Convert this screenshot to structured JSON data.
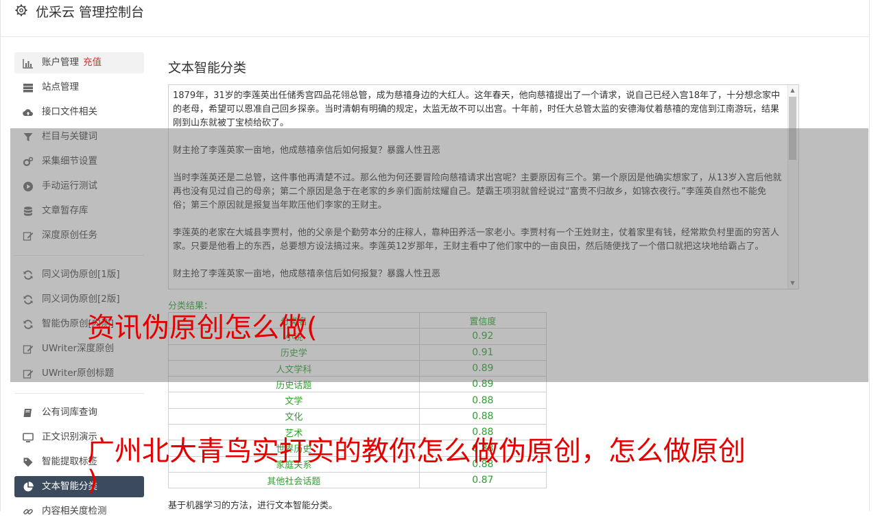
{
  "header": {
    "title": "优采云 管理控制台",
    "icon": "gear-icon"
  },
  "sidebar": {
    "groups": [
      [
        {
          "label": "账户管理",
          "badge": "充值",
          "icon": "bar-chart-icon"
        },
        {
          "label": "站点管理",
          "icon": "server-icon"
        },
        {
          "label": "接口文件相关",
          "icon": "cloud-upload-icon"
        },
        {
          "label": "栏目与关键词",
          "icon": "filter-icon"
        },
        {
          "label": "采集细节设置",
          "icon": "cogs-icon"
        },
        {
          "label": "手动运行测试",
          "icon": "play-circle-icon"
        },
        {
          "label": "文章暂存库",
          "icon": "database-icon"
        },
        {
          "label": "深度原创任务",
          "icon": "edit-icon"
        }
      ],
      [
        {
          "label": "同义词伪原创[1版]",
          "icon": "refresh-icon"
        },
        {
          "label": "同义词伪原创[2版]",
          "icon": "refresh-icon"
        },
        {
          "label": "智能伪原创[内测]",
          "icon": "refresh-icon"
        },
        {
          "label": "UWriter深度原创",
          "icon": "edit-icon"
        },
        {
          "label": "UWriter原创标题",
          "icon": "edit-icon"
        }
      ],
      [
        {
          "label": "公有词库查询",
          "icon": "book-icon"
        },
        {
          "label": "正文识别演示",
          "icon": "monitor-icon"
        },
        {
          "label": "智能提取标签",
          "icon": "tag-icon"
        },
        {
          "label": "文本智能分类",
          "icon": "pie-chart-icon"
        },
        {
          "label": "内容相关度检测",
          "icon": "link-icon"
        }
      ]
    ]
  },
  "main": {
    "title": "文本智能分类",
    "text_paragraphs": [
      "1879年，31岁的李莲英出任储秀宫四品花翎总管，成为慈禧身边的大红人。这年春天，他向慈禧提出了一个请求，说自己已经入宫18年了，十分想念家中的老母，希望可以恩准自己回乡探亲。当时清朝有明确的规定，太监无故不可以出宫。十年前，时任大总管太监的安德海仗着慈禧的宠信到江南游玩，结果刚到山东就被丁宝桢给砍了。",
      "财主抢了李莲英家一亩地，他成慈禧亲信后如何报复？暴露人性丑恶",
      "当时李莲英还是二总管，这件事他再清楚不过。那么他为何还要冒险向慈禧请求出宫呢？主要原因有三个。第一个原因是他确实想家了，从13岁入宫后他就再也没有见过自己的母亲；第二个原因是急于在老家的乡亲们面前炫耀自己。楚霸王项羽就曾经说过“富贵不归故乡，如锦衣夜行。”李莲英自然也不能免俗；第三个原因就是报复当年欺压他们李家的王财主。",
      "李莲英的老家在大城县李贾村，他的父亲是个勤劳本分的庄稼人，靠种田养活一家老小。李贾村有一个王姓财主，仗着家里有钱，经常欺负村里面的穷苦人家。只要是他看上的东西，总要想方设法搞过来。李莲英12岁那年，王财主看中了他们家中的一亩良田，然后随便找了一个借口就把这块地给霸占了。",
      "财主抢了李莲英家一亩地，他成慈禧亲信后如何报复？暴露人性丑恶"
    ],
    "result_label": "分类结果：",
    "table_headers": [
      "分类名",
      "置信度"
    ],
    "rows": [
      {
        "name": "小说",
        "conf": "0.92"
      },
      {
        "name": "历史学",
        "conf": "0.91"
      },
      {
        "name": "人文学科",
        "conf": "0.89"
      },
      {
        "name": "历史话题",
        "conf": "0.89"
      },
      {
        "name": "文学",
        "conf": "0.88"
      },
      {
        "name": "文化",
        "conf": "0.88"
      },
      {
        "name": "艺术",
        "conf": "0.88"
      },
      {
        "name": "世界历史",
        "conf": "0.88"
      },
      {
        "name": "家庭关系",
        "conf": "0.88"
      },
      {
        "name": "其他社会话题",
        "conf": "0.87"
      }
    ],
    "footnote": "基于机器学习的方法，进行文本智能分类。"
  },
  "overlay_captions": [
    "资讯伪原创怎么做(",
    "广州北大青鸟实打实的教你怎么做伪原创，怎么做原创",
    ")"
  ]
}
